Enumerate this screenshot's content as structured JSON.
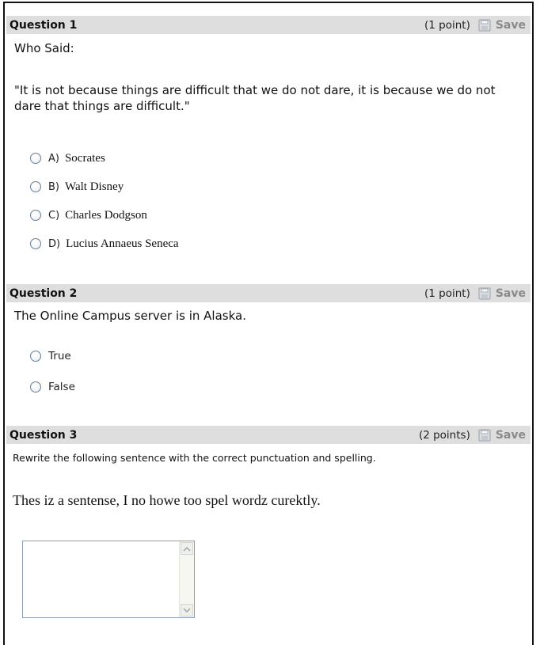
{
  "questions": [
    {
      "number": "Question 1",
      "points": "(1 point)",
      "save_label": "Save",
      "prompt_line1": "Who Said:",
      "quote": "\"It is not because things are difficult that we do not dare, it is because we do not dare that things are difficult.\"",
      "options": [
        {
          "letter": "A)",
          "text": "Socrates"
        },
        {
          "letter": "B)",
          "text": "Walt Disney"
        },
        {
          "letter": "C)",
          "text": "Charles Dodgson"
        },
        {
          "letter": "D)",
          "text": "Lucius Annaeus Seneca"
        }
      ]
    },
    {
      "number": "Question 2",
      "points": "(1 point)",
      "save_label": "Save",
      "prompt": "The Online Campus server is in Alaska.",
      "options": [
        {
          "text": "True"
        },
        {
          "text": "False"
        }
      ]
    },
    {
      "number": "Question 3",
      "points": "(2 points)",
      "save_label": "Save",
      "instruction": "Rewrite the following sentence with the correct punctuation and spelling.",
      "sentence": "Thes iz a sentense, I no howe too spel wordz curektly.",
      "answer_value": ""
    }
  ],
  "icons": {
    "save": "save-disk-icon",
    "scroll_up": "scroll-up-arrow-icon",
    "scroll_down": "scroll-down-arrow-icon"
  },
  "colors": {
    "header_bg": "#dedede",
    "save_text": "#8a8a8a",
    "radio_border": "#6a7f95"
  }
}
